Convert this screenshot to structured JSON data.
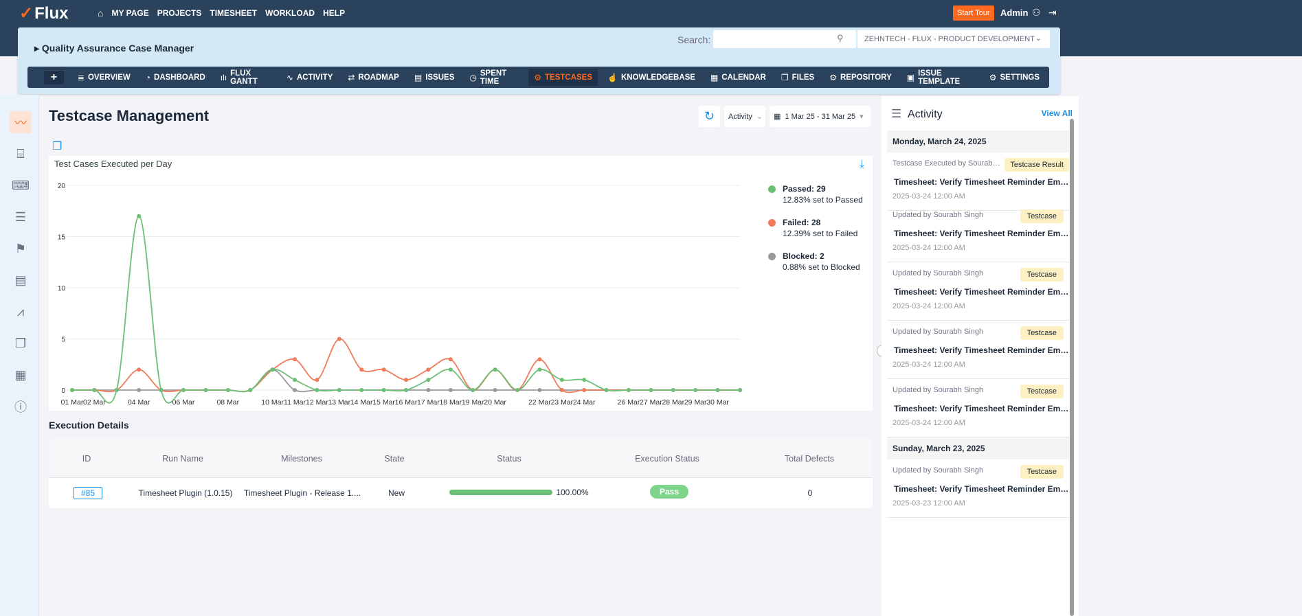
{
  "topbar": {
    "logo": "Flux",
    "nav": [
      "MY PAGE",
      "PROJECTS",
      "TIMESHEET",
      "WORKLOAD",
      "HELP"
    ],
    "start_tour": "Start Tour",
    "user": "Admin"
  },
  "project": {
    "title": "Quality Assurance Case Manager",
    "search_label": "Search:",
    "search_value": "",
    "project_select": "ZEHNTECH - FLUX - PRODUCT DEVELOPMENT"
  },
  "modules": [
    {
      "label": "OVERVIEW",
      "icon": "overview-icon"
    },
    {
      "label": "DASHBOARD",
      "icon": "dashboard-icon"
    },
    {
      "label": "FLUX GANTT",
      "icon": "gantt-icon"
    },
    {
      "label": "ACTIVITY",
      "icon": "activity-icon"
    },
    {
      "label": "ROADMAP",
      "icon": "roadmap-icon"
    },
    {
      "label": "ISSUES",
      "icon": "issues-icon"
    },
    {
      "label": "SPENT TIME",
      "icon": "clock-icon"
    },
    {
      "label": "TESTCASES",
      "icon": "testcases-icon",
      "active": true
    },
    {
      "label": "KNOWLEDGEBASE",
      "icon": "knowledgebase-icon"
    },
    {
      "label": "CALENDAR",
      "icon": "calendar-icon"
    },
    {
      "label": "FILES",
      "icon": "files-icon"
    },
    {
      "label": "REPOSITORY",
      "icon": "repository-icon"
    },
    {
      "label": "ISSUE TEMPLATE",
      "icon": "template-icon"
    },
    {
      "label": "SETTINGS",
      "icon": "gear-icon"
    }
  ],
  "page": {
    "title": "Testcase Management",
    "filter": "Activity",
    "date_range": "1 Mar 25 - 31 Mar 25"
  },
  "chart_data": {
    "type": "line",
    "title": "Test Cases Executed per Day",
    "ylim": [
      0,
      20
    ],
    "yticks": [
      0,
      5,
      10,
      15,
      20
    ],
    "grid": true,
    "legend": "right",
    "smooth": true,
    "x": [
      "01 Mar",
      "02 Mar",
      "03 Mar",
      "04 Mar",
      "05 Mar",
      "06 Mar",
      "07 Mar",
      "08 Mar",
      "09 Mar",
      "10 Mar",
      "11 Mar",
      "12 Mar",
      "13 Mar",
      "14 Mar",
      "15 Mar",
      "16 Mar",
      "17 Mar",
      "18 Mar",
      "19 Mar",
      "20 Mar",
      "21 Mar",
      "22 Mar",
      "23 Mar",
      "24 Mar",
      "25 Mar",
      "26 Mar",
      "27 Mar",
      "28 Mar",
      "29 Mar",
      "30 Mar",
      "31 Mar"
    ],
    "xtick_labels_shown": [
      "01 Mar",
      "02 Mar",
      "04 Mar",
      "06 Mar",
      "08 Mar",
      "10 Mar",
      "11 Mar",
      "12 Mar",
      "13 Mar",
      "14 Mar",
      "15 Mar",
      "16 Mar",
      "17 Mar",
      "18 Mar",
      "19 Mar",
      "20 Mar",
      "22 Mar",
      "23 Mar",
      "24 Mar",
      "26 Mar",
      "27 Mar",
      "28 Mar",
      "29 Mar",
      "30 Mar"
    ],
    "series": [
      {
        "name": "Passed",
        "color": "#6cbf76",
        "values": [
          0,
          0,
          0,
          17,
          0,
          0,
          0,
          0,
          0,
          2,
          1,
          0,
          0,
          0,
          0,
          0,
          1,
          2,
          0,
          2,
          0,
          2,
          1,
          1,
          0,
          0,
          0,
          0,
          0,
          0,
          0
        ]
      },
      {
        "name": "Failed",
        "color": "#f07a5a",
        "values": [
          0,
          0,
          0,
          2,
          0,
          0,
          0,
          0,
          0,
          2,
          3,
          1,
          5,
          2,
          2,
          1,
          2,
          3,
          0,
          2,
          0,
          3,
          0,
          0,
          0,
          0,
          0,
          0,
          0,
          0,
          0
        ]
      },
      {
        "name": "Blocked",
        "color": "#999999",
        "values": [
          0,
          0,
          0,
          0,
          0,
          0,
          0,
          0,
          0,
          2,
          0,
          0,
          0,
          0,
          0,
          0,
          0,
          0,
          0,
          0,
          0,
          0,
          0,
          0,
          0,
          0,
          0,
          0,
          0,
          0,
          0
        ]
      }
    ],
    "legend_entries": [
      {
        "label": "Passed: 29",
        "sub": "12.83% set to Passed"
      },
      {
        "label": "Failed: 28",
        "sub": "12.39% set to Failed"
      },
      {
        "label": "Blocked: 2",
        "sub": "0.88% set to Blocked"
      }
    ]
  },
  "execution": {
    "title": "Execution Details",
    "columns": [
      "ID",
      "Run Name",
      "Milestones",
      "State",
      "Status",
      "Execution Status",
      "Total Defects"
    ],
    "rows": [
      {
        "id": "#85",
        "run_name": "Timesheet Plugin (1.0.15)",
        "milestone": "Timesheet Plugin - Release 1....",
        "state": "New",
        "progress": 100,
        "progress_label": "100.00%",
        "execution_status": "Pass",
        "defects": "0"
      }
    ]
  },
  "activity": {
    "title": "Activity",
    "view_all": "View All",
    "days": [
      {
        "date": "Monday, March 24, 2025"
      },
      {
        "date": "Sunday, March 23, 2025"
      }
    ],
    "items": [
      {
        "by": "Testcase Executed by Sourabh Singh",
        "badge": "Testcase Result",
        "title": "Timesheet: Verify Timesheet Reminder Email",
        "time": "2025-03-24 12:00 AM"
      },
      {
        "by": "Updated by Sourabh Singh",
        "badge": "Testcase",
        "title": "Timesheet: Verify Timesheet Reminder Email",
        "time": "2025-03-24 12:00 AM"
      },
      {
        "by": "Updated by Sourabh Singh",
        "badge": "Testcase",
        "title": "Timesheet: Verify Timesheet Reminder Email",
        "time": "2025-03-24 12:00 AM"
      },
      {
        "by": "Updated by Sourabh Singh",
        "badge": "Testcase",
        "title": "Timesheet: Verify Timesheet Reminder Email",
        "time": "2025-03-24 12:00 AM"
      },
      {
        "by": "Updated by Sourabh Singh",
        "badge": "Testcase",
        "title": "Timesheet: Verify Timesheet Reminder Email",
        "time": "2025-03-24 12:00 AM"
      },
      {
        "by": "Updated by Sourabh Singh",
        "badge": "Testcase",
        "title": "Timesheet: Verify Timesheet Reminder Email",
        "time": "2025-03-23 12:00 AM"
      }
    ]
  }
}
